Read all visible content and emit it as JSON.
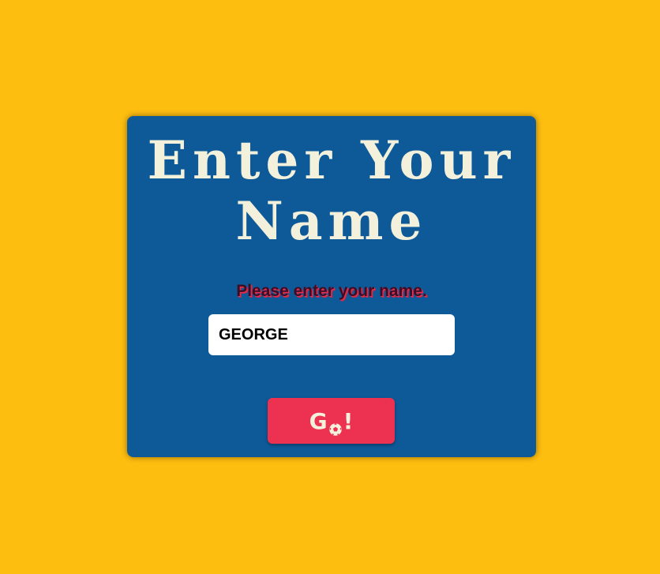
{
  "title": {
    "line1": "Enter Your",
    "line2": "Name"
  },
  "prompt": "Please enter your name.",
  "name_input": {
    "value": "GEORGE",
    "placeholder": ""
  },
  "go_button": {
    "text_before": "G",
    "icon": "soccer-ball-icon",
    "text_after": "!"
  },
  "colors": {
    "background": "#FEBE10",
    "card": "#0E5A99",
    "title_text": "#F3F1DC",
    "button": "#EC3250",
    "prompt_shadow": "#E8334F"
  }
}
